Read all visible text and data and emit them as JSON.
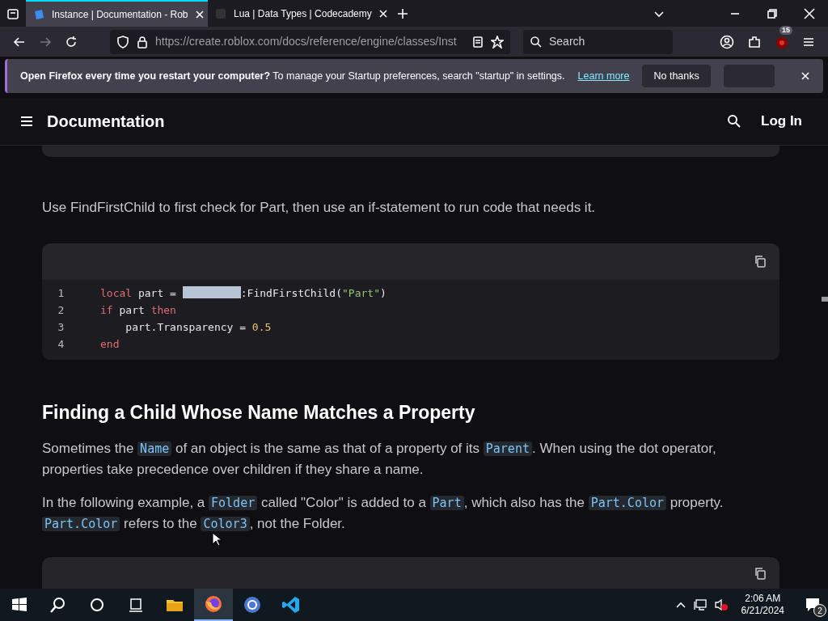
{
  "browser": {
    "tabs": [
      {
        "title": "Instance | Documentation - Rob",
        "selected": true
      },
      {
        "title": "Lua | Data Types | Codecademy",
        "selected": false
      }
    ],
    "url": "https://create.roblox.com/docs/reference/engine/classes/Inst",
    "search_placeholder": "Search",
    "extension_badge": "15"
  },
  "notification": {
    "bold": "Open Firefox every time you restart your computer?",
    "text": "To manage your Startup preferences, search \"startup\" in settings.",
    "link": "Learn more",
    "button": "No thanks"
  },
  "site_header": {
    "title": "Documentation",
    "login": "Log In"
  },
  "intro": "Use FindFirstChild to first check for Part, then use an if-statement to run code that needs it.",
  "code_block": {
    "lines": [
      {
        "number": "1",
        "tokens": [
          {
            "kind": "keyword",
            "text": "local"
          },
          {
            "kind": "plain",
            "text": " part = "
          },
          {
            "kind": "selection"
          },
          {
            "kind": "plain",
            "text": ":FindFirstChild("
          },
          {
            "kind": "string",
            "text": "\"Part\""
          },
          {
            "kind": "plain",
            "text": ")"
          }
        ]
      },
      {
        "number": "2",
        "tokens": [
          {
            "kind": "keyword",
            "text": "if"
          },
          {
            "kind": "plain",
            "text": " part "
          },
          {
            "kind": "keyword",
            "text": "then"
          }
        ]
      },
      {
        "number": "3",
        "tokens": [
          {
            "kind": "plain",
            "text": "    part.Transparency = "
          },
          {
            "kind": "number",
            "text": "0.5"
          }
        ]
      },
      {
        "number": "4",
        "tokens": [
          {
            "kind": "keyword",
            "text": "end"
          }
        ]
      }
    ]
  },
  "heading": "Finding a Child Whose Name Matches a Property",
  "paragraphs": [
    [
      {
        "kind": "text",
        "text": "Sometimes the "
      },
      {
        "kind": "code",
        "text": "Name"
      },
      {
        "kind": "text",
        "text": " of an object is the same as that of a property of its "
      },
      {
        "kind": "code",
        "text": "Parent"
      },
      {
        "kind": "text",
        "text": ". When using the dot operator, properties take precedence over children if they share a name."
      }
    ],
    [
      {
        "kind": "text",
        "text": "In the following example, a "
      },
      {
        "kind": "code",
        "text": "Folder"
      },
      {
        "kind": "text",
        "text": " called \"Color\" is added to a "
      },
      {
        "kind": "code",
        "text": "Part"
      },
      {
        "kind": "text",
        "text": ", which also has the "
      },
      {
        "kind": "code",
        "text": "Part.Color"
      },
      {
        "kind": "text",
        "text": " property. "
      },
      {
        "kind": "code",
        "text": "Part.Color"
      },
      {
        "kind": "text",
        "text": " refers to the "
      },
      {
        "kind": "code",
        "text": "Color3"
      },
      {
        "kind": "text",
        "text": ", not the Folder."
      }
    ]
  ],
  "taskbar": {
    "apps": [
      {
        "kind": "explorer",
        "active": false
      },
      {
        "kind": "firefox",
        "active": true
      },
      {
        "kind": "chrome",
        "active": false
      },
      {
        "kind": "vscode",
        "active": false
      }
    ],
    "time": "2:06 AM",
    "date": "6/21/2024",
    "notification_count": "2"
  }
}
